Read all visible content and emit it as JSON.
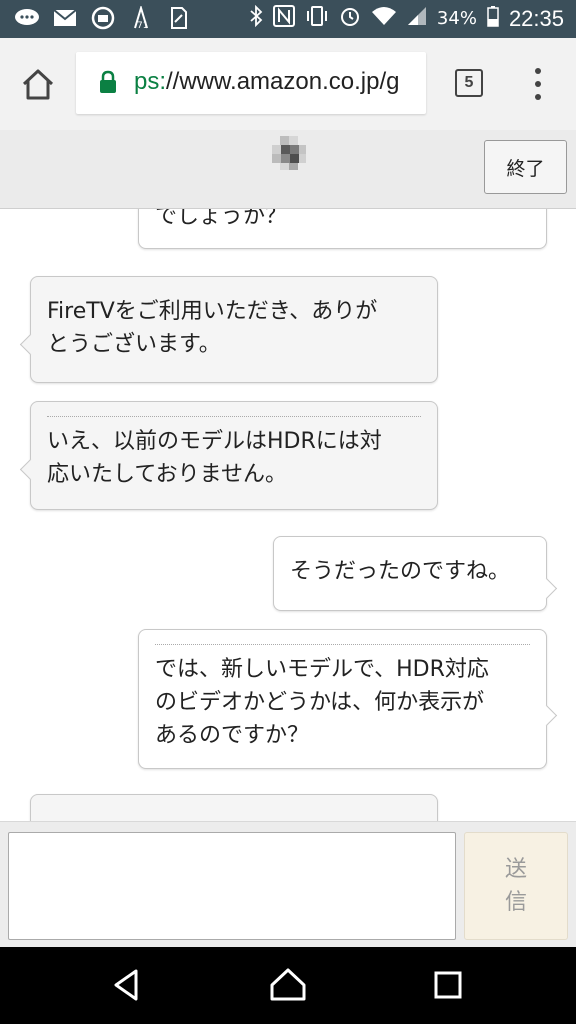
{
  "status_bar": {
    "battery": "34%",
    "time": "22:35",
    "icons": [
      "messenger-icon",
      "mail-icon",
      "photo-icon",
      "signal-stats-icon",
      "sim-icon",
      "bluetooth-icon",
      "nfc-icon",
      "vibrate-icon",
      "alarm-icon",
      "wifi-icon",
      "cell-signal-icon",
      "battery-icon"
    ]
  },
  "browser": {
    "url_scheme": "ps:",
    "url_rest": "//www.amazon.co.jp/g",
    "tab_count": "5"
  },
  "chat_header": {
    "end_button": "終了"
  },
  "messages": [
    {
      "side": "right",
      "text": "でしょうか？",
      "clipped": true
    },
    {
      "side": "left",
      "text": "FireTVをご利用いただき、ありが\nとうございます。"
    },
    {
      "side": "left",
      "text": "いえ、以前のモデルはHDRには対\n応いたしておりません。",
      "separator": true
    },
    {
      "side": "right",
      "text": "そうだったのですね。"
    },
    {
      "side": "right",
      "text": "では、新しいモデルで、HDR対応\nのビデオかどうかは、何か表示が\nあるのですか？",
      "separator": true
    },
    {
      "side": "left",
      "text": "",
      "clipped": true
    }
  ],
  "input": {
    "value": "",
    "send_label_1": "送",
    "send_label_2": "信"
  },
  "colors": {
    "status_bar": "#3b4f5a",
    "secure_green": "#0b8043",
    "send_bg": "#f7f1e3"
  }
}
